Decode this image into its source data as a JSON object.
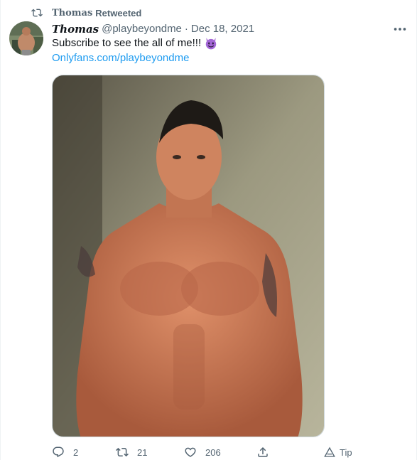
{
  "retweet": {
    "icon": "retweet-icon",
    "name": "Thomas",
    "label": "Retweeted"
  },
  "tweet": {
    "author_display_name": "Thomas",
    "handle": "@playbeyondme",
    "separator": "·",
    "date": "Dec 18, 2021",
    "text": "Subscribe to see the all of me!!!",
    "emoji": "smiling-imp-emoji",
    "link": "Onlyfans.com/playbeyondme",
    "media": "photo"
  },
  "actions": {
    "reply_count": "2",
    "retweet_count": "21",
    "like_count": "206",
    "tip_label": "Tip"
  },
  "colors": {
    "text_primary": "#0f1419",
    "text_secondary": "#536471",
    "link": "#1d9bf0",
    "emoji_purple": "#a366d6"
  }
}
